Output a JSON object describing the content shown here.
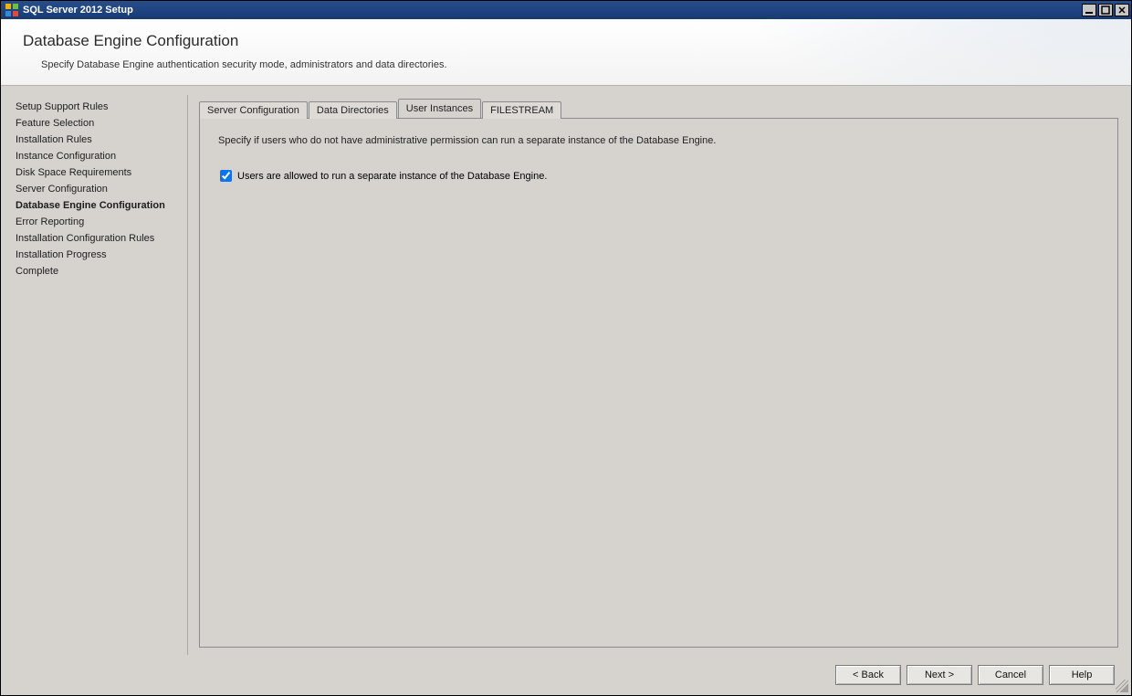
{
  "window": {
    "title": "SQL Server 2012 Setup"
  },
  "header": {
    "title": "Database Engine Configuration",
    "subtitle": "Specify Database Engine authentication security mode, administrators and data directories."
  },
  "sidebar": {
    "items": [
      {
        "label": "Setup Support Rules",
        "active": false
      },
      {
        "label": "Feature Selection",
        "active": false
      },
      {
        "label": "Installation Rules",
        "active": false
      },
      {
        "label": "Instance Configuration",
        "active": false
      },
      {
        "label": "Disk Space Requirements",
        "active": false
      },
      {
        "label": "Server Configuration",
        "active": false
      },
      {
        "label": "Database Engine Configuration",
        "active": true
      },
      {
        "label": "Error Reporting",
        "active": false
      },
      {
        "label": "Installation Configuration Rules",
        "active": false
      },
      {
        "label": "Installation Progress",
        "active": false
      },
      {
        "label": "Complete",
        "active": false
      }
    ]
  },
  "tabs": [
    {
      "label": "Server Configuration",
      "active": false
    },
    {
      "label": "Data Directories",
      "active": false
    },
    {
      "label": "User Instances",
      "active": true
    },
    {
      "label": "FILESTREAM",
      "active": false
    }
  ],
  "panel": {
    "description": "Specify if users who do not have administrative permission can run a separate instance of the Database Engine.",
    "checkbox_label": "Users are allowed to run a separate instance of the Database Engine.",
    "checkbox_checked": true
  },
  "footer": {
    "back": "< Back",
    "next": "Next >",
    "cancel": "Cancel",
    "help": "Help"
  }
}
